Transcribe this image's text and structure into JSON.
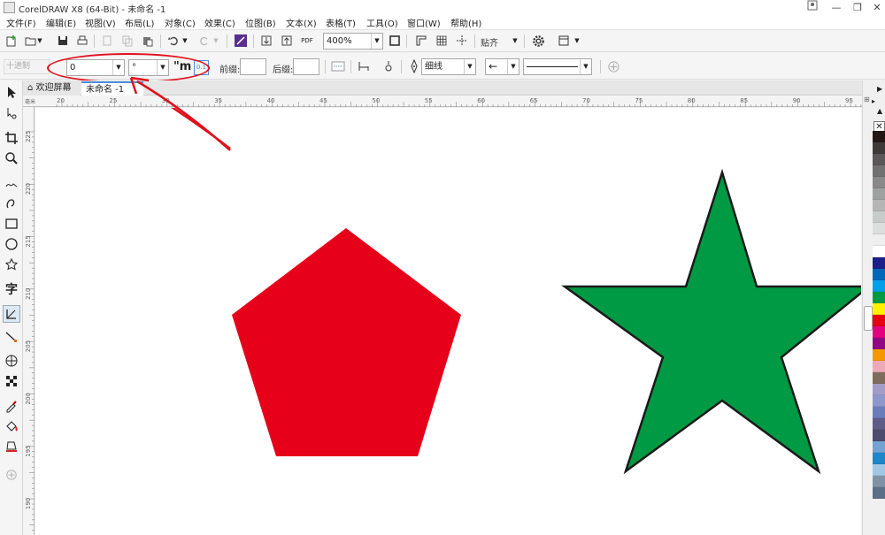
{
  "app": {
    "title": "CorelDRAW X8 (64-Bit) - 未命名 -1"
  },
  "menu": [
    "文件(F)",
    "编辑(E)",
    "视图(V)",
    "布局(L)",
    "对象(C)",
    "效果(C)",
    "位图(B)",
    "文本(X)",
    "表格(T)",
    "工具(O)",
    "窗口(W)",
    "帮助(H)"
  ],
  "toolbar1": {
    "zoom": "400%",
    "snap_label": "贴齐",
    "pdf_label": "PDF"
  },
  "toolbar2": {
    "number_system": "十进制",
    "value_field": "0",
    "unit_field": "°",
    "prefix_label": "前缀:",
    "suffix_label": "后缀:",
    "line_width": "细线",
    "font_icon_text": "\"m",
    "small_text": "0.1"
  },
  "tabs": {
    "welcome": "欢迎屏幕",
    "doc": "未命名 -1"
  },
  "ruler": {
    "h_ticks": [
      "20",
      "25",
      "30",
      "35",
      "40",
      "45",
      "50",
      "55",
      "60",
      "65",
      "70",
      "75",
      "80",
      "85",
      "90",
      "95"
    ],
    "h_unit": "毫米",
    "v_ticks": [
      "225",
      "220",
      "215",
      "210",
      "205",
      "200",
      "195",
      "190"
    ]
  },
  "shapes": {
    "pentagon_color": "#e6001a",
    "star_color": "#009944",
    "star_stroke": "#1a1a1a"
  },
  "palette": [
    "#231815",
    "#3e3a39",
    "#595757",
    "#727171",
    "#898989",
    "#9fa0a0",
    "#b5b5b6",
    "#c9caca",
    "#dcdddd",
    "#efefef",
    "#ffffff",
    "#1d2088",
    "#0068b7",
    "#00a0e9",
    "#009944",
    "#fff100",
    "#e60012",
    "#e4007f",
    "#920783",
    "#f39800",
    "#eea9b8",
    "#7f6b5d",
    "#a39bc8",
    "#8c97cb",
    "#6a7dbb",
    "#5f5c87",
    "#4b4c6e",
    "#73a2d3",
    "#1f86c8",
    "#a0c8e6",
    "#8093a6",
    "#5b6f86"
  ]
}
